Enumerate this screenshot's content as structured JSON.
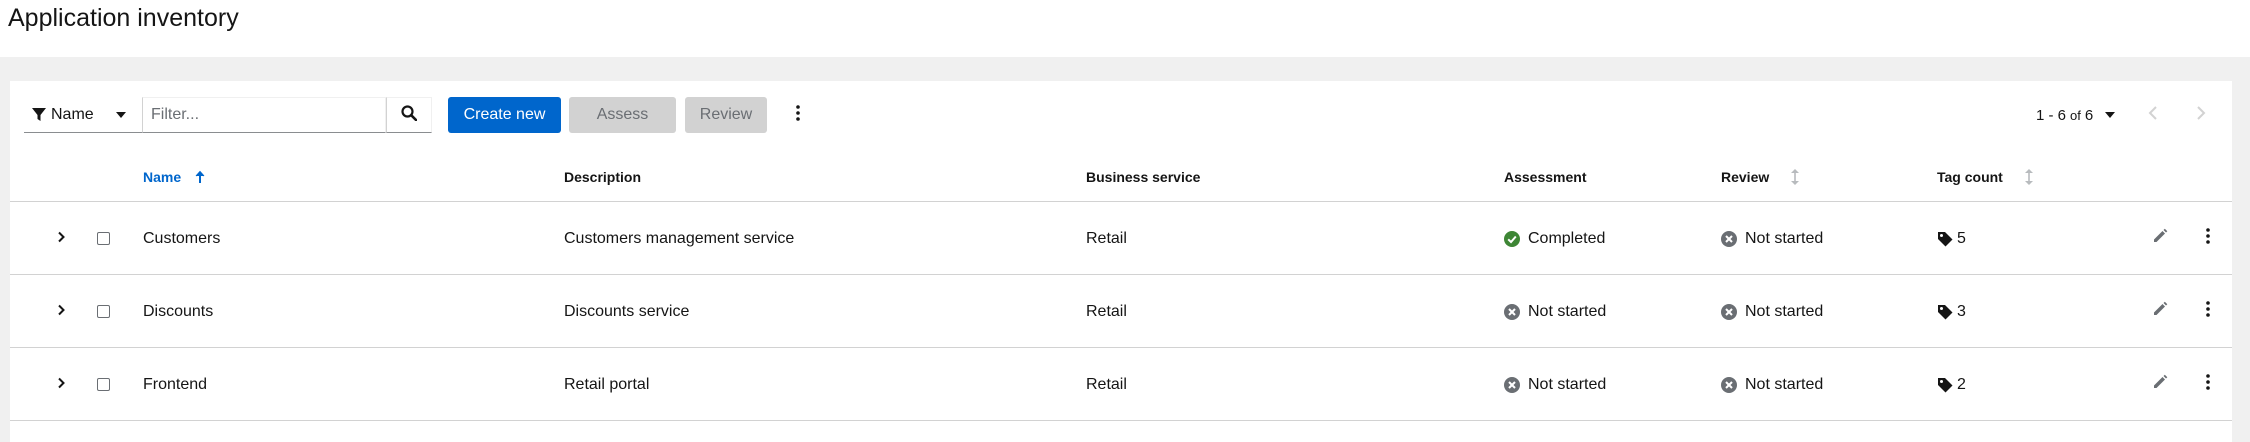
{
  "page": {
    "title": "Application inventory"
  },
  "toolbar": {
    "filter_category": "Name",
    "filter_placeholder": "Filter...",
    "create_label": "Create new",
    "assess_label": "Assess",
    "review_label": "Review"
  },
  "pagination": {
    "range": "1 - 6",
    "of": "of",
    "total": "6"
  },
  "table": {
    "columns": {
      "name": "Name",
      "description": "Description",
      "business_service": "Business service",
      "assessment": "Assessment",
      "review": "Review",
      "tag_count": "Tag count"
    },
    "rows": [
      {
        "name": "Customers",
        "description": "Customers management service",
        "business_service": "Retail",
        "assessment": "Completed",
        "assessment_state": "completed",
        "review": "Not started",
        "tag_count": "5"
      },
      {
        "name": "Discounts",
        "description": "Discounts service",
        "business_service": "Retail",
        "assessment": "Not started",
        "assessment_state": "not-started",
        "review": "Not started",
        "tag_count": "3"
      },
      {
        "name": "Frontend",
        "description": "Retail portal",
        "business_service": "Retail",
        "assessment": "Not started",
        "assessment_state": "not-started",
        "review": "Not started",
        "tag_count": "2"
      }
    ]
  },
  "colors": {
    "primary": "#0066cc",
    "completed": "#3e8635",
    "not_started": "#6a6e73",
    "disabled_bg": "#d2d2d2"
  },
  "icons": [
    "filter-icon",
    "caret-down-icon",
    "search-icon",
    "kebab-icon",
    "angle-left-icon",
    "angle-right-icon",
    "sort-up-icon",
    "sort-icon",
    "chevron-right-icon",
    "check-circle-icon",
    "times-circle-icon",
    "tag-icon",
    "pencil-icon"
  ]
}
